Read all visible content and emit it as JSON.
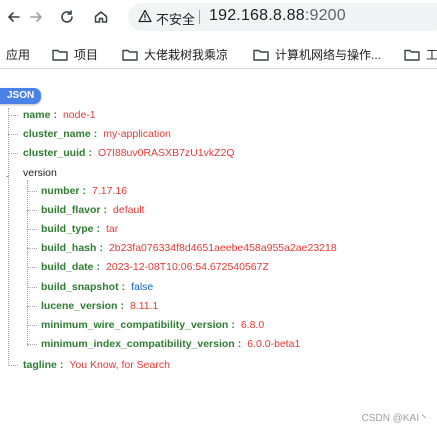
{
  "browser": {
    "insecure_label": "不安全",
    "url_host": "192.168.8.88",
    "url_port": ":9200"
  },
  "bookmarks": {
    "apps_label": "应用",
    "items": [
      "项目",
      "大佬栽树我乘凉",
      "计算机网络与操作...",
      "工"
    ]
  },
  "viewer": {
    "badge": "JSON",
    "fields": {
      "name": {
        "key": "name",
        "value": "node-1"
      },
      "cluster_name": {
        "key": "cluster_name",
        "value": "my-application"
      },
      "cluster_uuid": {
        "key": "cluster_uuid",
        "value": "O7I88uv0RASXB7zU1vkZ2Q"
      },
      "version_key": "version",
      "number": {
        "key": "number",
        "value": "7.17.16"
      },
      "build_flavor": {
        "key": "build_flavor",
        "value": "default"
      },
      "build_type": {
        "key": "build_type",
        "value": "tar"
      },
      "build_hash": {
        "key": "build_hash",
        "value": "2b23fa076334f8d4651aeebe458a955a2ae23218"
      },
      "build_date": {
        "key": "build_date",
        "value": "2023-12-08T10:06:54.672540567Z"
      },
      "build_snapshot": {
        "key": "build_snapshot",
        "value": "false"
      },
      "lucene_version": {
        "key": "lucene_version",
        "value": "8.11.1"
      },
      "min_wire": {
        "key": "minimum_wire_compatibility_version",
        "value": "6.8.0"
      },
      "min_index": {
        "key": "minimum_index_compatibility_version",
        "value": "6.0.0-beta1"
      },
      "tagline": {
        "key": "tagline",
        "value": "You Know, for Search"
      }
    },
    "toggle_symbol": "-"
  },
  "watermark": "CSDN @KAI丶"
}
